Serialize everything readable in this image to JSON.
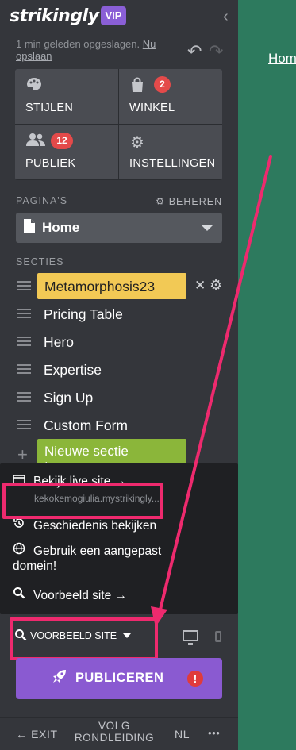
{
  "brand": {
    "logo": "strikingly",
    "vip": "VIP"
  },
  "save": {
    "status": "1 min geleden opgeslagen.",
    "link": "Nu opslaan"
  },
  "tiles": [
    {
      "label": "STIJLEN",
      "icon": "palette-icon"
    },
    {
      "label": "WINKEL",
      "icon": "shopping-bag-icon",
      "badge": "2"
    },
    {
      "label": "PUBLIEK",
      "icon": "users-icon",
      "badge": "12"
    },
    {
      "label": "INSTELLINGEN",
      "icon": "gear-icon"
    }
  ],
  "pages": {
    "label": "PAGINA'S",
    "manage": "BEHEREN",
    "current": "Home"
  },
  "sections": {
    "label": "SECTIES",
    "items": [
      "Metamorphosis23",
      "Pricing Table",
      "Hero",
      "Expertise",
      "Sign Up",
      "Custom Form"
    ],
    "new_section": "Nieuwe sectie toevoegen"
  },
  "menu": {
    "live": "Bekijk live site →",
    "live_url": "kekokemogiulia.mystrikingly...",
    "history": "Geschiedenis bekijken",
    "domain_line1": "Gebruik een aangepast",
    "domain_line2": "domein!",
    "preview": "Voorbeeld site →"
  },
  "bottom": {
    "preview_dropdown": "VOORBEELD SITE",
    "publish": "PUBLICEREN",
    "publish_alert": "!"
  },
  "footer": {
    "exit": "EXIT",
    "tour_line1": "VOLG",
    "tour_line2": "RONDLEIDING",
    "lang": "NL",
    "more": "•••"
  },
  "preview_page": {
    "link": "Hom"
  },
  "colors": {
    "sidebar": "#34363b",
    "canvas": "#2d7a5e",
    "accent": "#8a5ad1",
    "active_section": "#f2c955",
    "new_section": "#8bb63a",
    "highlight": "#ee2a6e"
  }
}
